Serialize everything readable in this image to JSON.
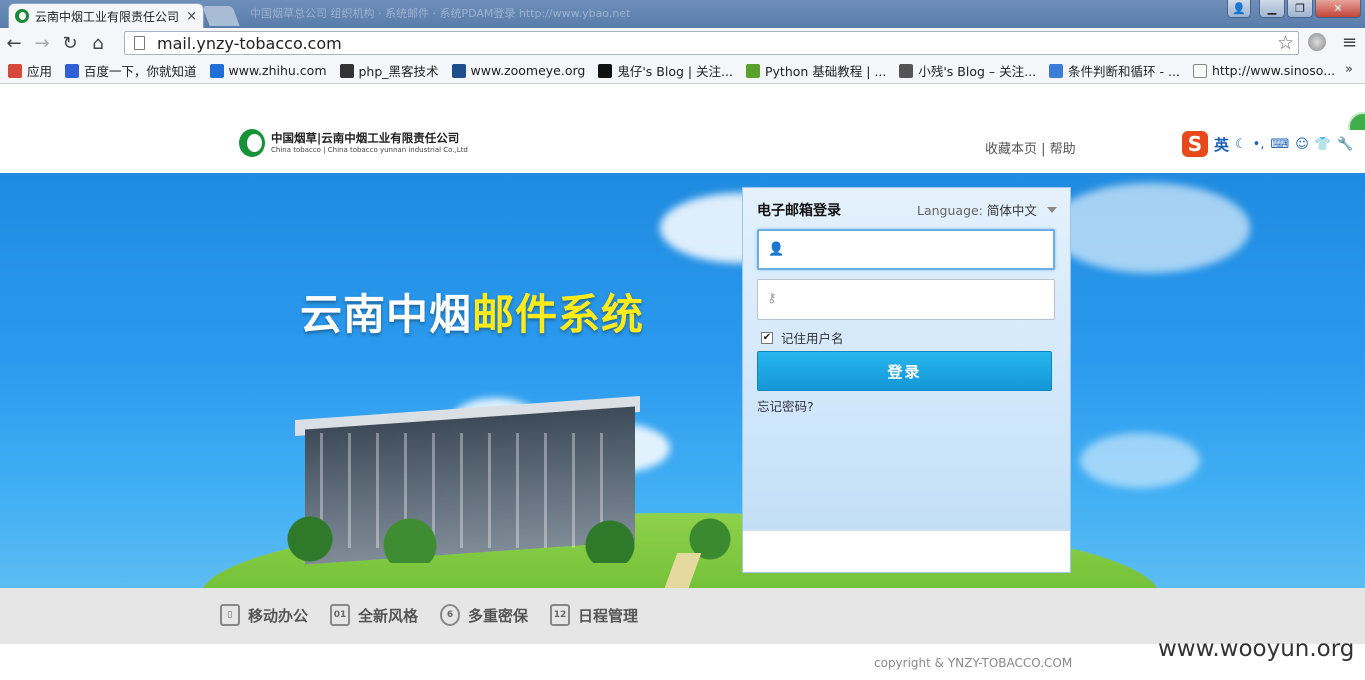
{
  "browser": {
    "tab_title": "云南中烟工业有限责任公司",
    "tab_close": "×",
    "ghost_text": "中国烟草总公司 组织机构 · 系统邮件 · 系统PDAM登录 http://www.ybao.net",
    "url": "mail.ynzy-tobacco.com",
    "window_buttons": {
      "minimize": "▁",
      "maximize": "❐",
      "close": "✕",
      "user": "👤"
    },
    "bookmarks": [
      {
        "label": "应用",
        "color": "#d7473a"
      },
      {
        "label": "百度一下，你就知道",
        "color": "#3160d6"
      },
      {
        "label": "www.zhihu.com",
        "color": "#1f6fd6"
      },
      {
        "label": "php_黑客技术",
        "color": "#333333"
      },
      {
        "label": "www.zoomeye.org",
        "color": "#1e4e8c"
      },
      {
        "label": "鬼仔's Blog | 关注...",
        "color": "#111111"
      },
      {
        "label": "Python 基础教程 | ...",
        "color": "#5aa02c"
      },
      {
        "label": "小残's Blog – 关注...",
        "color": "#555555"
      },
      {
        "label": "条件判断和循环 - ...",
        "color": "#3b7dd8"
      },
      {
        "label": "http://www.sinoso...",
        "color": "#ffffff"
      }
    ],
    "bookmarks_more": "»"
  },
  "header": {
    "logo_cn": "中国烟草|云南中烟工业有限责任公司",
    "logo_en": "China tobacco | China tobacco yunnan industrial Co.,Ltd",
    "links": "收藏本页 | 帮助",
    "ime": {
      "logo": "S",
      "lang": "英",
      "icons": [
        "☾",
        "•,",
        "⌨",
        "☺",
        "👕",
        "🔧"
      ]
    }
  },
  "banner": {
    "slogan_white": "云南中烟",
    "slogan_yellow": "邮件系统"
  },
  "login": {
    "title": "电子邮箱登录",
    "language_label": "Language:",
    "language_value": "简体中文",
    "username_value": "",
    "password_value": "",
    "remember_label": "记住用户名",
    "remember_checked": true,
    "submit_label": "登录",
    "forgot_label": "忘记密码?"
  },
  "features": [
    {
      "label": "移动办公",
      "icon": "mobile-icon"
    },
    {
      "label": "全新风格",
      "icon": "style-icon"
    },
    {
      "label": "多重密保",
      "icon": "security-icon"
    },
    {
      "label": "日程管理",
      "icon": "calendar-icon"
    }
  ],
  "footer": {
    "copyright": "copyright & YNZY-TOBACCO.COM",
    "watermark": "www.wooyun.org"
  },
  "colors": {
    "banner_top": "#1f8be0",
    "slogan_yellow": "#ffeb1a",
    "login_button": "#1ba7e3",
    "brand_green": "#189238"
  }
}
